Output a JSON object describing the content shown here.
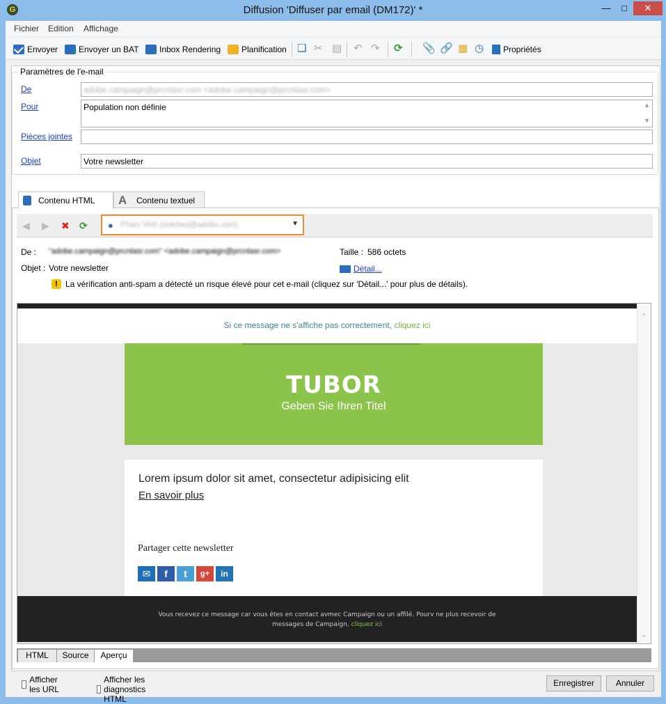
{
  "window": {
    "title": "Diffusion 'Diffuser par email (DM172)' *",
    "app_icon": "G"
  },
  "menu": [
    "Fichier",
    "Edition",
    "Affichage"
  ],
  "toolbar": {
    "send": "Envoyer",
    "send_proof": "Envoyer un BAT",
    "inbox_rendering": "Inbox Rendering",
    "planning": "Planification",
    "properties": "Propriétés"
  },
  "email_params": {
    "legend": "Paramètres de l'e-mail",
    "from_label": "De",
    "from_value": "adobe.campaign@prcnlasr.com <adobe.campaign@prcnlasr.com>",
    "to_label": "Pour",
    "to_value": "Population non définie",
    "attachments_label": "Pièces jointes",
    "attachments_value": "",
    "subject_label": "Objet",
    "subject_value": "Votre newsletter"
  },
  "tabs": {
    "html": "Contenu HTML",
    "text": "Contenu textuel"
  },
  "preview_toolbar": {
    "recipient": "Pham Vinh (notched@adobe.com)"
  },
  "meta": {
    "from_label": "De :",
    "from_value": "\"adobe.campaign@prcnlasr.com\" <adobe.campaign@prcnlasr.com>",
    "subject_label": "Objet :",
    "subject_value": "Votre newsletter",
    "size_label": "Taille :",
    "size_value": "586 octets",
    "detail_link": "Détail...",
    "warning": "La vérification anti-spam a détecté un risque élevé pour cet e-mail (cliquez sur 'Détail...' pour plus de détails)."
  },
  "email_preview": {
    "header_text": "Si ce message ne s'affiche pas correctement,",
    "header_link": "cliquez ici",
    "logo": "TUBOR",
    "subtitle": "Geben Sie Ihren Titel",
    "body_text": "Lorem ipsum dolor sit amet, consectetur adipisicing elit",
    "more_link": "En savoir plus",
    "share_label": "Partager cette newsletter",
    "footer_line1": "Vous recevez ce message car vous êtes en contact avmec Campaign ou un affilé. Pourv ne plus recevoir de",
    "footer_line2": "messages de Campaign,",
    "footer_link": "cliquez ici"
  },
  "view_tabs": [
    "HTML",
    "Source",
    "Aperçu"
  ],
  "options": {
    "show_urls": "Afficher les URL",
    "show_diagnostics": "Afficher les diagnostics HTML"
  },
  "buttons": {
    "save": "Enregistrer",
    "cancel": "Annuler"
  }
}
